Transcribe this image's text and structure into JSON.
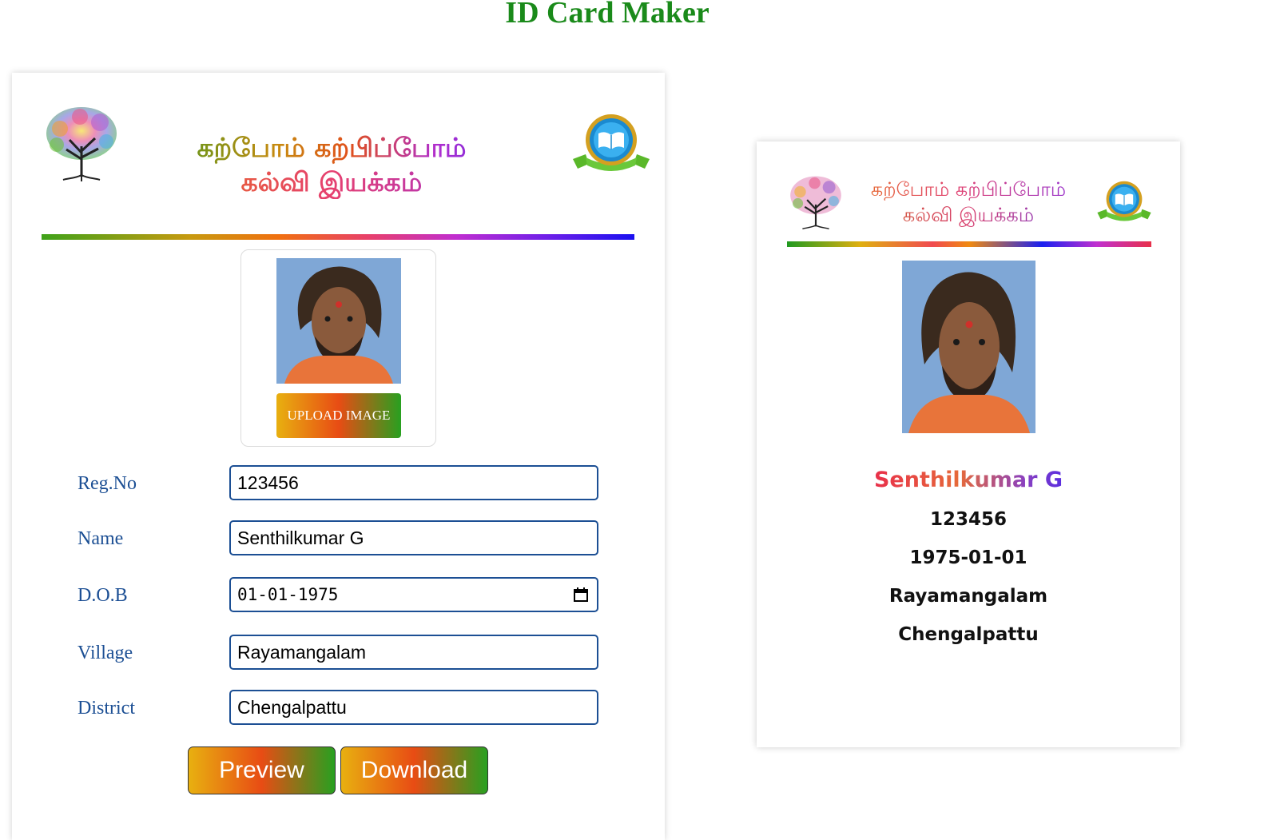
{
  "app": {
    "title": "ID Card Maker"
  },
  "header": {
    "line1": "கற்போம் கற்பிப்போம்",
    "line2": "கல்வி இயக்கம்",
    "left_logo": "tree-logo",
    "right_logo": "book-badge-logo"
  },
  "photo": {
    "upload_label": "UPLOAD IMAGE"
  },
  "form": {
    "fields": [
      {
        "label": "Reg.No",
        "value": "123456",
        "type": "text"
      },
      {
        "label": "Name",
        "value": "Senthilkumar G",
        "type": "text"
      },
      {
        "label": "D.O.B",
        "value": "01-01-1975",
        "type": "date"
      },
      {
        "label": "Village",
        "value": "Rayamangalam",
        "type": "text"
      },
      {
        "label": "District",
        "value": "Chengalpattu",
        "type": "text"
      }
    ],
    "preview_label": "Preview",
    "download_label": "Download"
  },
  "card": {
    "header_line1": "கற்போம் கற்பிப்போம்",
    "header_line2": "கல்வி இயக்கம்",
    "name": "Senthilkumar G",
    "reg_no": "123456",
    "dob": "1975-01-01",
    "village": "Rayamangalam",
    "district": "Chengalpattu"
  },
  "colors": {
    "title_green": "#1a8a1a",
    "label_blue": "#1c4f94",
    "button_gradient": [
      "#e8b010",
      "#e84c14",
      "#28a020"
    ]
  }
}
